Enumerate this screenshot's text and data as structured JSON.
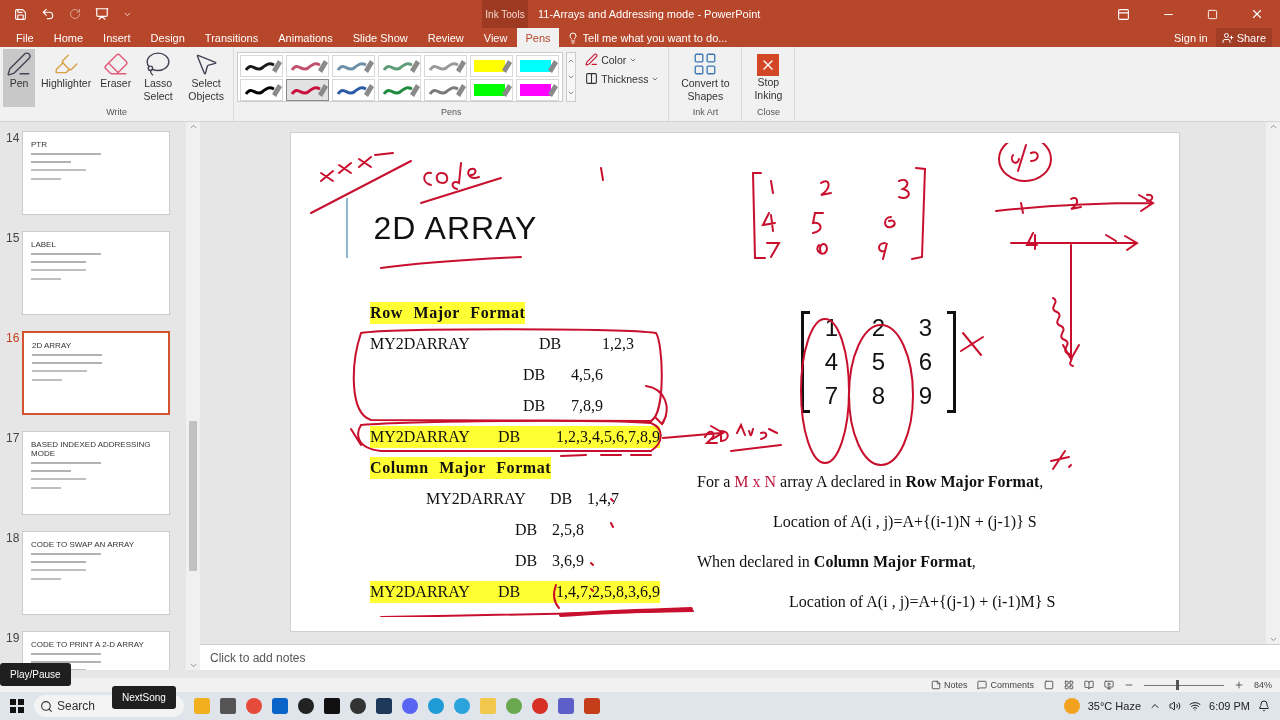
{
  "title_bar": {
    "context_label": "Ink Tools",
    "title": "11-Arrays and Addressing mode - PowerPoint"
  },
  "tabs": [
    {
      "label": "File",
      "selected": false
    },
    {
      "label": "Home",
      "selected": false
    },
    {
      "label": "Insert",
      "selected": false
    },
    {
      "label": "Design",
      "selected": false
    },
    {
      "label": "Transitions",
      "selected": false
    },
    {
      "label": "Animations",
      "selected": false
    },
    {
      "label": "Slide Show",
      "selected": false
    },
    {
      "label": "Review",
      "selected": false
    },
    {
      "label": "View",
      "selected": false
    },
    {
      "label": "Pens",
      "selected": true
    }
  ],
  "tell_me": {
    "placeholder": "Tell me what you want to do..."
  },
  "account": {
    "sign_in": "Sign in",
    "share": "Share"
  },
  "ribbon": {
    "write": {
      "label": "Write",
      "tools": [
        {
          "kind": "pen",
          "label": "Pen",
          "selected": true
        },
        {
          "kind": "highlighter",
          "label": "Highlighter",
          "selected": false
        },
        {
          "kind": "eraser",
          "label": "Eraser",
          "selected": false
        },
        {
          "kind": "lasso",
          "label": "Lasso Select",
          "selected": false
        },
        {
          "kind": "select",
          "label": "Select Objects",
          "selected": false
        }
      ]
    },
    "pens": {
      "label": "Pens",
      "swatches": [
        {
          "kind": "pen",
          "color": "#1a1a1a",
          "selected": false
        },
        {
          "kind": "pen",
          "color": "#c0506e",
          "selected": false
        },
        {
          "kind": "pen",
          "color": "#6e8fa8",
          "selected": false
        },
        {
          "kind": "pen",
          "color": "#5e9c78",
          "selected": false
        },
        {
          "kind": "pen",
          "color": "#9a9a9a",
          "selected": false
        },
        {
          "kind": "highlighter",
          "color": "#ffff00",
          "selected": false
        },
        {
          "kind": "highlighter",
          "color": "#00ffff",
          "selected": false
        },
        {
          "kind": "pen",
          "color": "#000000",
          "selected": false
        },
        {
          "kind": "pen",
          "color": "#c8103c",
          "selected": true
        },
        {
          "kind": "pen",
          "color": "#2a5aa8",
          "selected": false
        },
        {
          "kind": "pen",
          "color": "#1e8a3c",
          "selected": false
        },
        {
          "kind": "pen",
          "color": "#7a7a7a",
          "selected": false
        },
        {
          "kind": "highlighter",
          "color": "#00ff00",
          "selected": false
        },
        {
          "kind": "highlighter",
          "color": "#ff00ff",
          "selected": false
        }
      ],
      "color_label": "Color",
      "thickness_label": "Thickness"
    },
    "ink_art": {
      "label": "Ink Art",
      "button": "Convert to Shapes"
    },
    "close": {
      "label": "Close",
      "button": "Stop Inking"
    }
  },
  "thumbnails": [
    {
      "number": "14",
      "title": "PTR",
      "selected": false
    },
    {
      "number": "15",
      "title": "LABEL",
      "selected": false
    },
    {
      "number": "16",
      "title": "2D ARRAY",
      "selected": true
    },
    {
      "number": "17",
      "title": "BASED INDEXED ADDRESSING MODE",
      "selected": false
    },
    {
      "number": "18",
      "title": "CODE TO SWAP AN ARRAY",
      "selected": false
    },
    {
      "number": "19",
      "title": "CODE TO  PRINT A 2-D ARRAY",
      "selected": false
    }
  ],
  "slide": {
    "title": "2D ARRAY",
    "sections": [
      {
        "heading": "Row Major Format",
        "lines": [
          {
            "kind": "first",
            "label": "MY2DARRAY",
            "op": "DB",
            "values": "1,2,3",
            "highlighted": false
          },
          {
            "kind": "cont",
            "op": "DB",
            "values": "4,5,6",
            "highlighted": false
          },
          {
            "kind": "cont",
            "op": "DB",
            "values": "7,8,9",
            "highlighted": false
          },
          {
            "kind": "combined",
            "label": "MY2DARRAY",
            "op": "DB",
            "values": "1,2,3,4,5,6,7,8,9",
            "highlighted": true
          }
        ]
      },
      {
        "heading": "Column Major Format",
        "lines": [
          {
            "kind": "first_col",
            "label": "MY2DARRAY",
            "op": "DB",
            "values": "1,4,7",
            "highlighted": false
          },
          {
            "kind": "cont_col",
            "op": "DB",
            "values": "2,5,8",
            "highlighted": false
          },
          {
            "kind": "cont_col",
            "op": "DB",
            "values": "3,6,9",
            "highlighted": false
          },
          {
            "kind": "combined",
            "label": "MY2DARRAY",
            "op": "DB",
            "values": "1,4,7,2,5,8,3,6,9",
            "highlighted": true
          }
        ]
      }
    ],
    "matrix": [
      [
        "1",
        "2",
        "3"
      ],
      [
        "4",
        "5",
        "6"
      ],
      [
        "7",
        "8",
        "9"
      ]
    ],
    "formulas": [
      {
        "kind": "statement",
        "parts": [
          {
            "kind": "plain",
            "text": "For a "
          },
          {
            "kind": "accent",
            "text": "M x N"
          },
          {
            "kind": "plain",
            "text": " array A declared in "
          },
          {
            "kind": "bold",
            "text": "Row Major Format"
          },
          {
            "kind": "plain",
            "text": ","
          }
        ]
      },
      {
        "kind": "formula",
        "parts": [
          {
            "kind": "plain",
            "text": "Location of  A(i , j)=A+{(i-1)N + (j-1)} S"
          }
        ]
      },
      {
        "kind": "statement",
        "parts": [
          {
            "kind": "plain",
            "text": "When declared in  "
          },
          {
            "kind": "bold",
            "text": "Column Major Format"
          },
          {
            "kind": "plain",
            "text": ","
          }
        ]
      },
      {
        "kind": "formula_wide",
        "parts": [
          {
            "kind": "plain",
            "text": "Location of  A(i , j)=A+{(j-1) + (i-1)M} S"
          }
        ]
      }
    ]
  },
  "notes": {
    "placeholder": "Click to add notes"
  },
  "status_bar": {
    "notes": "Notes",
    "comments": "Comments",
    "zoom": "84%",
    "zoom_slider": {
      "level": 0.4
    }
  },
  "overlays": {
    "play_pause": "Play/Pause",
    "next_song": "NextSong"
  },
  "taskbar": {
    "search": "Search",
    "weather": "35°C  Haze",
    "time": "6:09 PM"
  }
}
